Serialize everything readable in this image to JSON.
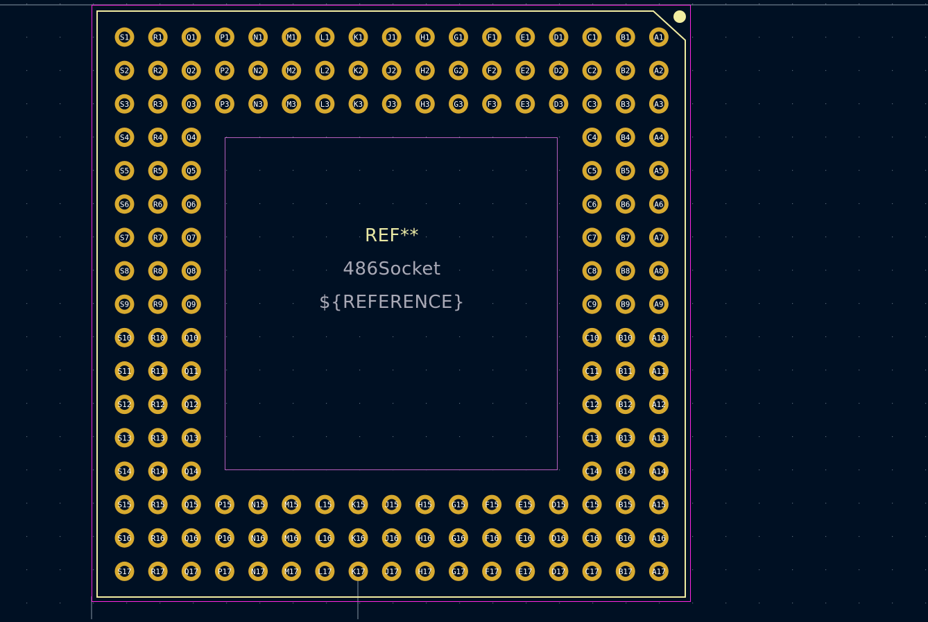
{
  "colors": {
    "background": "#001023",
    "pad": "#d8aa30",
    "silkscreen": "#f2eda1",
    "courtyard": "#ff26e2",
    "fab": "#b85fbf",
    "ref_text": "#e9e8a4",
    "value_text": "#a9a9b6",
    "grid_dot": "#5a6a7a",
    "cursor_line": "#8896a6"
  },
  "footprint": {
    "reference": "REF**",
    "value": "486Socket",
    "fab_reference": "${REFERENCE}"
  },
  "pad_grid": {
    "columns": [
      "S",
      "R",
      "Q",
      "P",
      "N",
      "M",
      "L",
      "K",
      "J",
      "H",
      "G",
      "F",
      "E",
      "D",
      "C",
      "B",
      "A"
    ],
    "rows": [
      "1",
      "2",
      "3",
      "4",
      "5",
      "6",
      "7",
      "8",
      "9",
      "10",
      "11",
      "12",
      "13",
      "14",
      "15",
      "16",
      "17"
    ],
    "outer_row_count": 3
  }
}
